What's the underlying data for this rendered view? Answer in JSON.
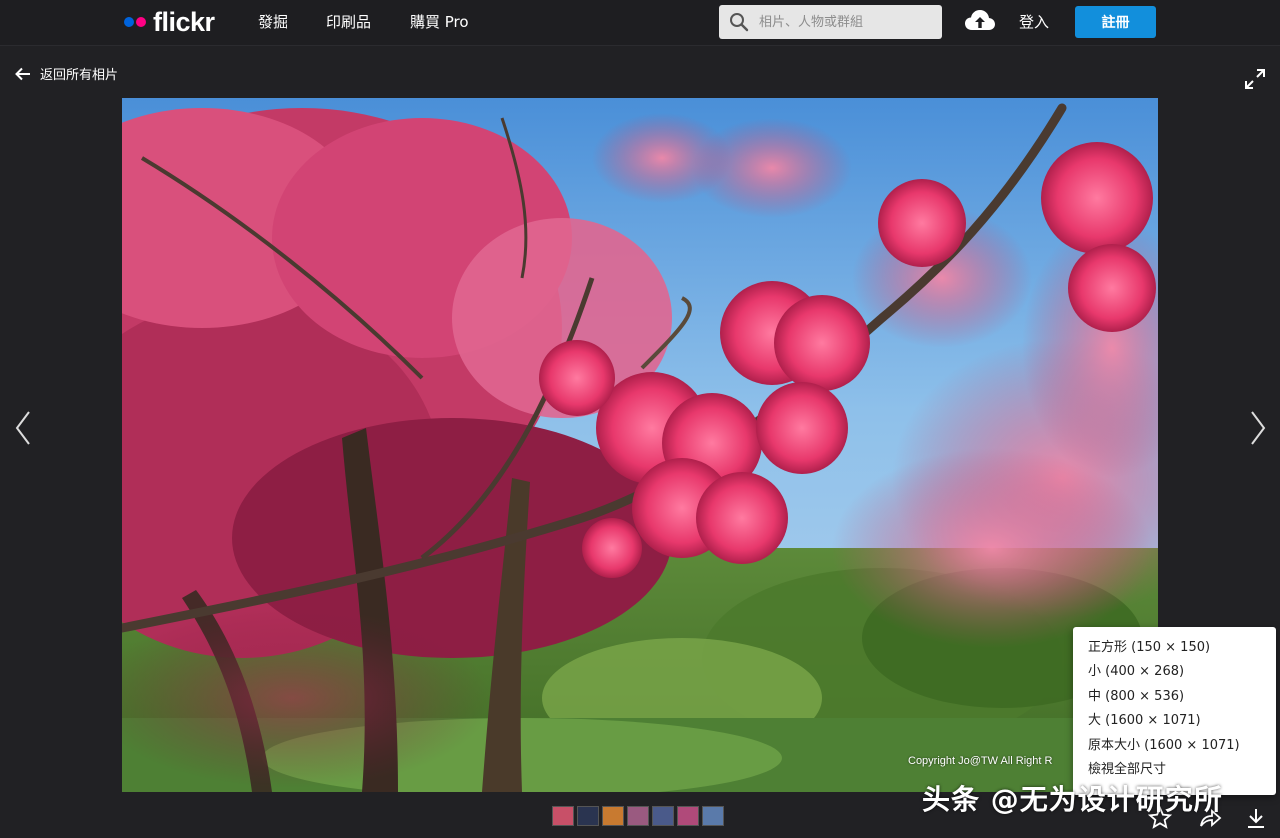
{
  "header": {
    "logo_text": "flickr",
    "nav": [
      "發掘",
      "印刷品",
      "購買 Pro"
    ],
    "search_placeholder": "相片、人物或群組",
    "login_label": "登入",
    "signup_label": "註冊"
  },
  "subbar": {
    "back_label": "返回所有相片"
  },
  "photo": {
    "copyright": "Copyright  Jo@TW All  Right R"
  },
  "download_menu": {
    "items": [
      "正方形 (150 × 150)",
      "小 (400 × 268)",
      "中 (800 × 536)",
      "大 (1600 × 1071)",
      "原本大小 (1600 × 1071)",
      "檢視全部尺寸"
    ]
  },
  "filmstrip": {
    "thumb_colors": [
      "#c85068",
      "#2a3450",
      "#c87a30",
      "#9a5a80",
      "#4a5a8a",
      "#b04a7a",
      "#5a7aaa"
    ]
  },
  "watermark": {
    "text": "头条 @无为设计研究所"
  },
  "colors": {
    "background": "#212124",
    "signup_button": "#128fdc",
    "logo_blue": "#0063dc",
    "logo_pink": "#ff0084"
  }
}
